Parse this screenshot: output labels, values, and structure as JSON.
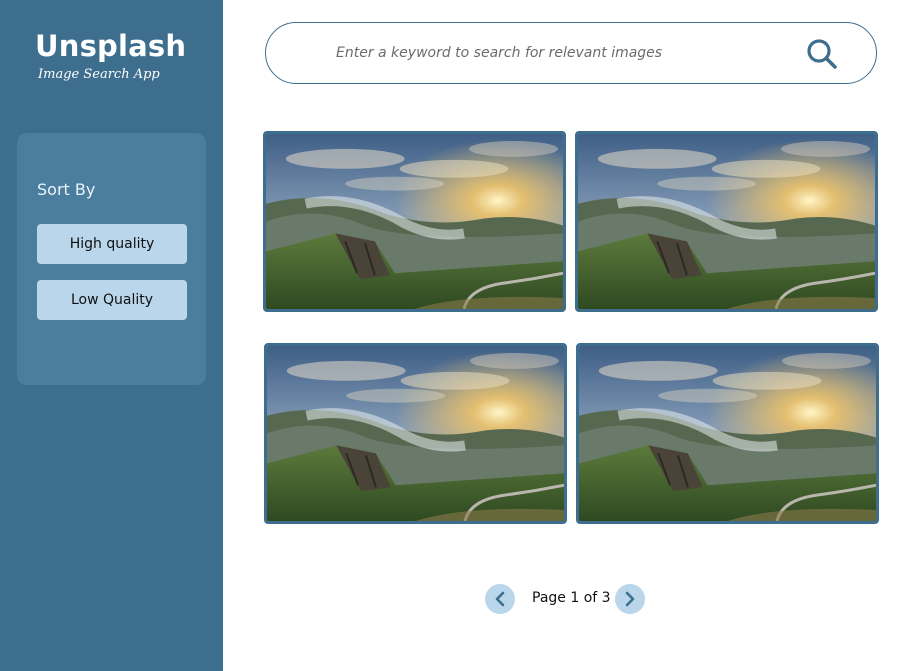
{
  "sidebar": {
    "brand_title": "Unsplash",
    "brand_subtitle": "Image Search App",
    "sort_label": "Sort By",
    "sort_options": [
      "High quality",
      "Low Quality"
    ]
  },
  "search": {
    "placeholder": "Enter a keyword to search for relevant images",
    "icon": "search-icon"
  },
  "gallery": {
    "images": [
      {
        "alt": "landscape"
      },
      {
        "alt": "landscape"
      },
      {
        "alt": "landscape"
      },
      {
        "alt": "landscape"
      }
    ]
  },
  "pagination": {
    "label": "Page 1 of 3",
    "current_page": 1,
    "total_pages": 3,
    "prev_icon": "chevron-left-icon",
    "next_icon": "chevron-right-icon"
  },
  "colors": {
    "sidebar": "#3d6e8e",
    "panel": "#4b7d9e",
    "button": "#b9d6ea",
    "accent": "#3d6e8e"
  }
}
